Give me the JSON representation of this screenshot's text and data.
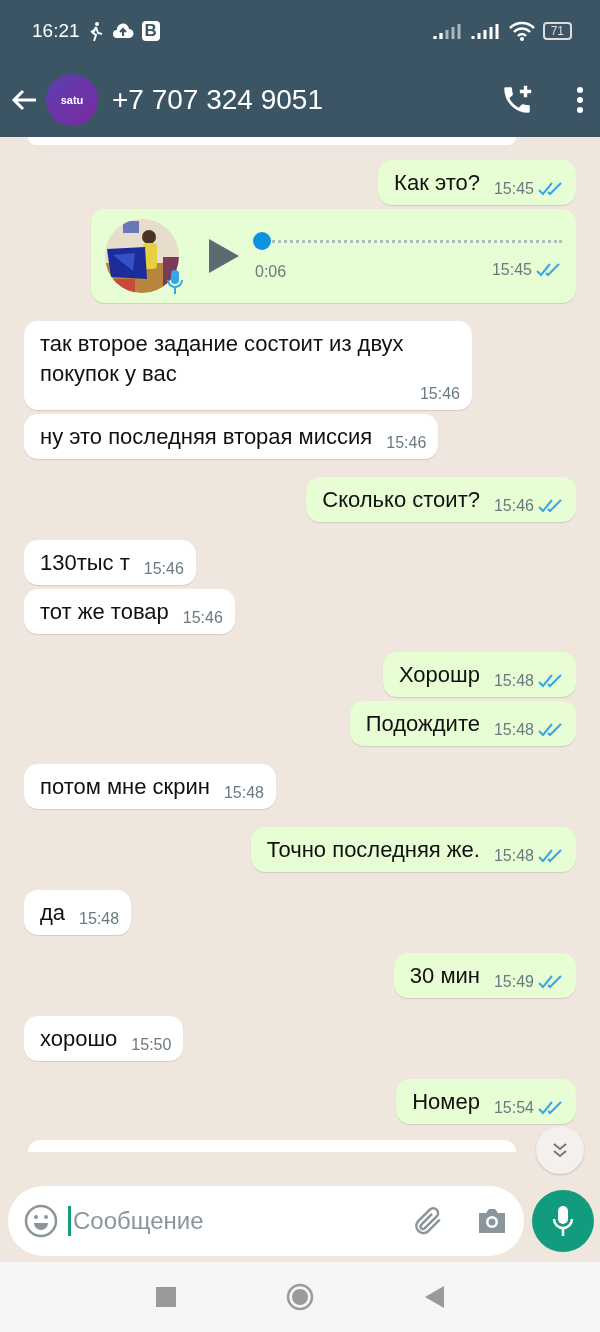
{
  "status_bar": {
    "time": "16:21",
    "badge": "B",
    "battery": "71"
  },
  "header": {
    "avatar_text": "satu",
    "title": "+7 707 324 9051"
  },
  "messages": [
    {
      "kind": "outgoing",
      "text": "Как это?",
      "time": "15:45",
      "read": true
    },
    {
      "kind": "voice",
      "duration": "0:06",
      "time": "15:45",
      "read": true,
      "level": 0
    },
    {
      "kind": "incoming",
      "text": "так второе задание состоит из двух покупок у вас",
      "time": "15:46"
    },
    {
      "kind": "incoming",
      "text": "ну это последняя вторая миссия",
      "time": "15:46"
    },
    {
      "kind": "outgoing",
      "text": "Сколько стоит?",
      "time": "15:46",
      "read": true
    },
    {
      "kind": "incoming",
      "text": "130тыс т",
      "time": "15:46"
    },
    {
      "kind": "incoming",
      "text": "тот же товар",
      "time": "15:46"
    },
    {
      "kind": "outgoing",
      "text": "Хорошр",
      "time": "15:48",
      "read": true
    },
    {
      "kind": "outgoing",
      "text": "Подождите",
      "time": "15:48",
      "read": true
    },
    {
      "kind": "incoming",
      "text": "потом мне скрин",
      "time": "15:48"
    },
    {
      "kind": "outgoing",
      "text": "Точно последняя же.",
      "time": "15:48",
      "read": true
    },
    {
      "kind": "incoming",
      "text": "да",
      "time": "15:48"
    },
    {
      "kind": "outgoing",
      "text": "30 мин",
      "time": "15:49",
      "read": true
    },
    {
      "kind": "incoming",
      "text": "хорошо",
      "time": "15:50"
    },
    {
      "kind": "outgoing",
      "text": "Номер",
      "time": "15:54",
      "read": true
    }
  ],
  "composer": {
    "placeholder": "Сообщение"
  }
}
